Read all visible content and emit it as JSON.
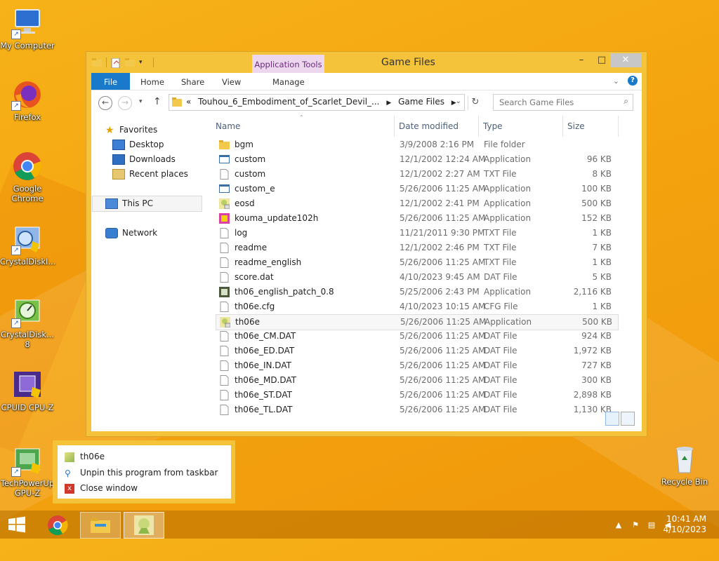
{
  "desktop": {
    "icons": [
      {
        "label": "My Computer"
      },
      {
        "label": "Firefox"
      },
      {
        "label": "Google Chrome"
      },
      {
        "label": "CrystalDiskI..."
      },
      {
        "label": "CrystalDisk... 8"
      },
      {
        "label": "CPUID CPU-Z"
      },
      {
        "label": "TechPowerUp GPU-Z"
      },
      {
        "label": "Recycle Bin"
      }
    ]
  },
  "window": {
    "title": "Game Files",
    "context_tab": "Application Tools",
    "ribbon_tabs": [
      "File",
      "Home",
      "Share",
      "View",
      "Manage"
    ],
    "address": {
      "prefix": "«",
      "segments": [
        "Touhou_6_Embodiment_of_Scarlet_Devil_...",
        "Game Files"
      ]
    },
    "search_placeholder": "Search Game Files",
    "nav": {
      "favorites": "Favorites",
      "desktop": "Desktop",
      "downloads": "Downloads",
      "recent": "Recent places",
      "thispc": "This PC",
      "network": "Network"
    },
    "columns": {
      "name": "Name",
      "date": "Date modified",
      "type": "Type",
      "size": "Size"
    },
    "files": [
      {
        "name": "bgm",
        "date": "3/9/2008 2:16 PM",
        "type": "File folder",
        "size": "",
        "icon": "folder"
      },
      {
        "name": "custom",
        "date": "12/1/2002 12:24 AM",
        "type": "Application",
        "size": "96 KB",
        "icon": "app"
      },
      {
        "name": "custom",
        "date": "12/1/2002 2:27 AM",
        "type": "TXT File",
        "size": "8 KB",
        "icon": "file"
      },
      {
        "name": "custom_e",
        "date": "5/26/2006 11:25 AM",
        "type": "Application",
        "size": "100 KB",
        "icon": "app"
      },
      {
        "name": "eosd",
        "date": "12/1/2002 2:41 PM",
        "type": "Application",
        "size": "500 KB",
        "icon": "game"
      },
      {
        "name": "kouma_update102h",
        "date": "5/26/2006 11:25 AM",
        "type": "Application",
        "size": "152 KB",
        "icon": "installer"
      },
      {
        "name": "log",
        "date": "11/21/2011 9:30 PM",
        "type": "TXT File",
        "size": "1 KB",
        "icon": "file"
      },
      {
        "name": "readme",
        "date": "12/1/2002 2:46 PM",
        "type": "TXT File",
        "size": "7 KB",
        "icon": "file"
      },
      {
        "name": "readme_english",
        "date": "5/26/2006 11:25 AM",
        "type": "TXT File",
        "size": "1 KB",
        "icon": "file"
      },
      {
        "name": "score.dat",
        "date": "4/10/2023 9:45 AM",
        "type": "DAT File",
        "size": "5 KB",
        "icon": "file"
      },
      {
        "name": "th06_english_patch_0.8",
        "date": "5/25/2006 2:43 PM",
        "type": "Application",
        "size": "2,116 KB",
        "icon": "patch"
      },
      {
        "name": "th06e.cfg",
        "date": "4/10/2023 10:15 AM",
        "type": "CFG File",
        "size": "1 KB",
        "icon": "file"
      },
      {
        "name": "th06e",
        "date": "5/26/2006 11:25 AM",
        "type": "Application",
        "size": "500 KB",
        "icon": "game",
        "selected": true
      },
      {
        "name": "th06e_CM.DAT",
        "date": "5/26/2006 11:25 AM",
        "type": "DAT File",
        "size": "924 KB",
        "icon": "file"
      },
      {
        "name": "th06e_ED.DAT",
        "date": "5/26/2006 11:25 AM",
        "type": "DAT File",
        "size": "1,972 KB",
        "icon": "file"
      },
      {
        "name": "th06e_IN.DAT",
        "date": "5/26/2006 11:25 AM",
        "type": "DAT File",
        "size": "727 KB",
        "icon": "file"
      },
      {
        "name": "th06e_MD.DAT",
        "date": "5/26/2006 11:25 AM",
        "type": "DAT File",
        "size": "300 KB",
        "icon": "file"
      },
      {
        "name": "th06e_ST.DAT",
        "date": "5/26/2006 11:25 AM",
        "type": "DAT File",
        "size": "2,898 KB",
        "icon": "file"
      },
      {
        "name": "th06e_TL.DAT",
        "date": "5/26/2006 11:25 AM",
        "type": "DAT File",
        "size": "1,130 KB",
        "icon": "file"
      }
    ]
  },
  "jumplist": {
    "app": "th06e",
    "unpin": "Unpin this program from taskbar",
    "close": "Close window"
  },
  "taskbar": {
    "time": "10:41 AM",
    "date": "4/10/2023"
  },
  "colors": {
    "accent": "#1979ca",
    "frame": "#f4c33a",
    "context_tab": "#ecd7ef"
  }
}
